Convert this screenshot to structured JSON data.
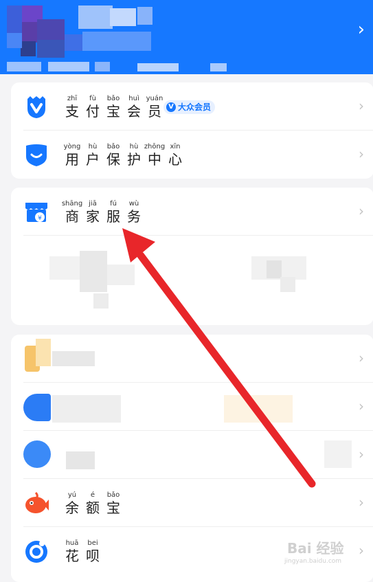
{
  "colors": {
    "header": "#1678ff",
    "accent": "#1677ff",
    "arrow": "#e8262a",
    "bg": "#f4f4f6"
  },
  "header": {
    "chevron": "›"
  },
  "card1": {
    "rows": [
      {
        "icon": "vip-member-icon",
        "pinyin": [
          "zhī",
          "fù",
          "bǎo",
          "huì",
          "yuán"
        ],
        "hanzi": [
          "支",
          "付",
          "宝",
          "会",
          "员"
        ],
        "badge": "大众会员"
      },
      {
        "icon": "shield-icon",
        "pinyin": [
          "yòng",
          "hù",
          "bǎo",
          "hù",
          "zhōng",
          "xīn"
        ],
        "hanzi": [
          "用",
          "户",
          "保",
          "护",
          "中",
          "心"
        ]
      }
    ]
  },
  "card2": {
    "rows": [
      {
        "icon": "merchant-store-icon",
        "pinyin": [
          "shāng",
          "jiā",
          "fú",
          "wù"
        ],
        "hanzi": [
          "商",
          "家",
          "服",
          "务"
        ]
      }
    ]
  },
  "card3": {
    "rows": [
      {
        "icon": "blurred-orange-icon"
      },
      {
        "icon": "blurred-blue-icon"
      },
      {
        "icon": "blurred-blue-coin-icon"
      },
      {
        "icon": "yuebao-fish-icon",
        "pinyin": [
          "yú",
          "é",
          "bǎo"
        ],
        "hanzi": [
          "余",
          "额",
          "宝"
        ]
      },
      {
        "icon": "huabei-icon",
        "pinyin": [
          "huā",
          "bei"
        ],
        "hanzi": [
          "花",
          "呗"
        ]
      }
    ]
  },
  "chevron": "›",
  "watermark": {
    "logo": "Bai  经验",
    "url": "jingyan.baidu.com"
  }
}
